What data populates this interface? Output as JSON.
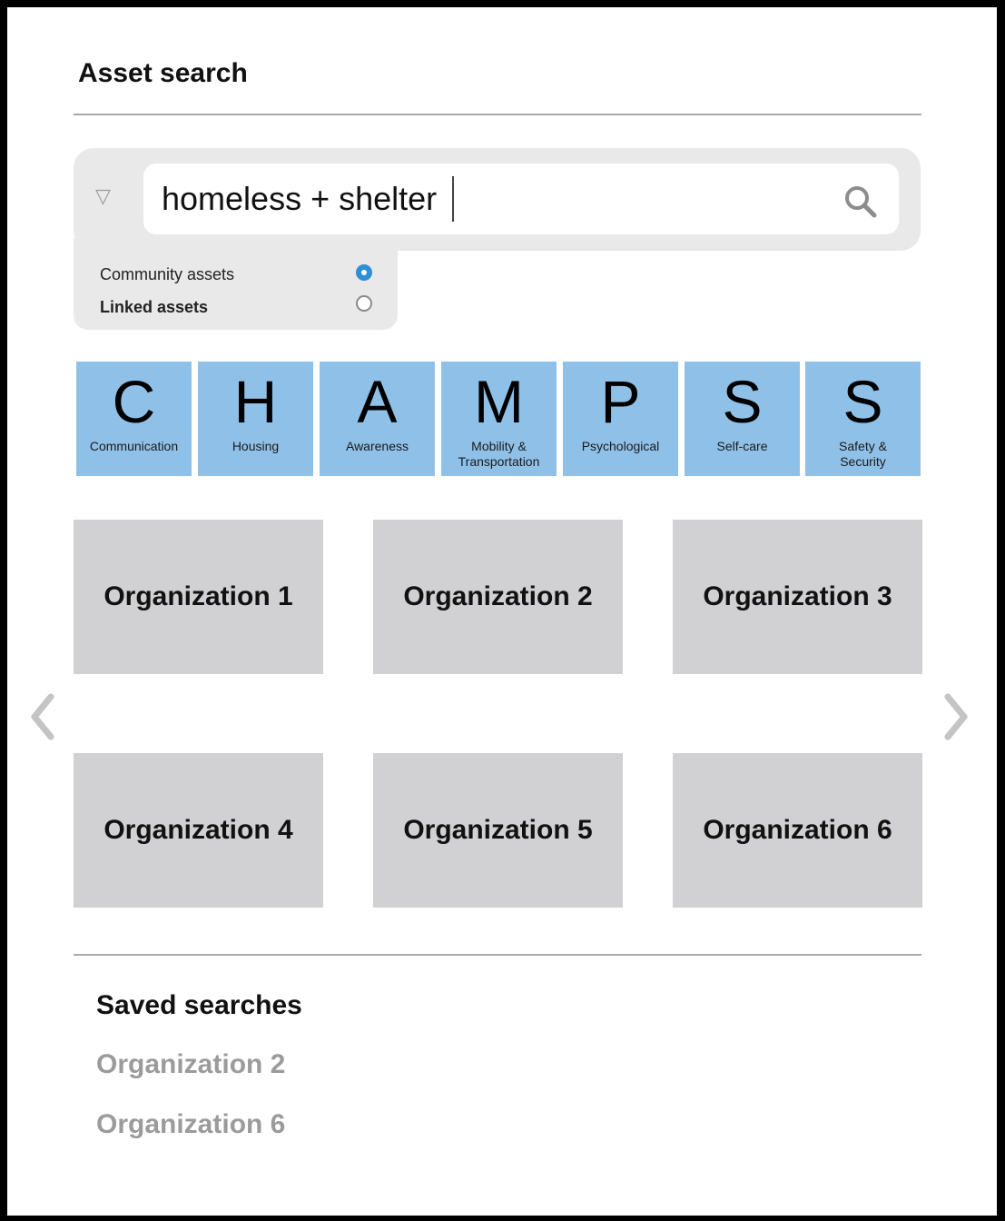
{
  "header": {
    "title": "Asset search"
  },
  "search": {
    "filter_icon": "triangle-down-icon",
    "query": "homeless + shelter",
    "search_icon": "magnifier-icon"
  },
  "filters": {
    "options": [
      {
        "label": "Community assets",
        "selected": true
      },
      {
        "label": "Linked assets",
        "selected": false
      }
    ]
  },
  "champs": {
    "tile_color": "#8fc1e8",
    "categories": [
      {
        "letter": "C",
        "label": "Communication"
      },
      {
        "letter": "H",
        "label": "Housing"
      },
      {
        "letter": "A",
        "label": "Awareness"
      },
      {
        "letter": "M",
        "label": "Mobility &\nTransportation"
      },
      {
        "letter": "P",
        "label": "Psychological"
      },
      {
        "letter": "S",
        "label": "Self-care"
      },
      {
        "letter": "S",
        "label": "Safety &\nSecurity"
      }
    ]
  },
  "results": {
    "organizations": [
      "Organization 1",
      "Organization 2",
      "Organization 3",
      "Organization 4",
      "Organization 5",
      "Organization 6"
    ],
    "prev_icon": "chevron-left-icon",
    "next_icon": "chevron-right-icon"
  },
  "saved": {
    "title": "Saved searches",
    "items": [
      "Organization 2",
      "Organization 6"
    ]
  },
  "colors": {
    "accent": "#2f8fd4",
    "card": "#d1d1d3",
    "panel": "#e9e9ea"
  }
}
